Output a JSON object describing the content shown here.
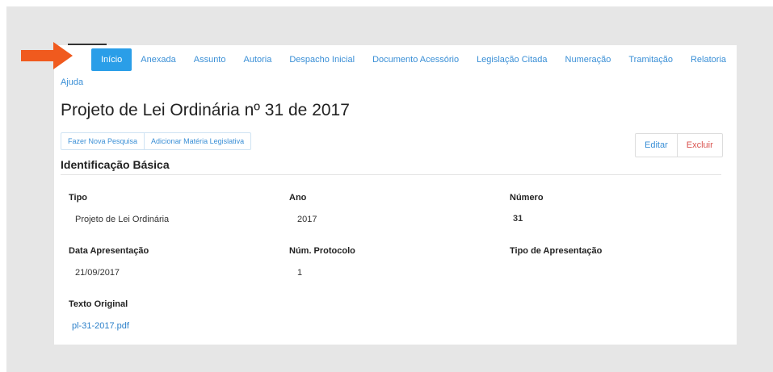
{
  "tabs": [
    {
      "label": "Início",
      "active": true
    },
    {
      "label": "Anexada"
    },
    {
      "label": "Assunto"
    },
    {
      "label": "Autoria"
    },
    {
      "label": "Despacho Inicial"
    },
    {
      "label": "Documento Acessório"
    },
    {
      "label": "Legislação Citada"
    },
    {
      "label": "Numeração"
    },
    {
      "label": "Tramitação"
    },
    {
      "label": "Relatoria"
    }
  ],
  "help_label": "Ajuda",
  "page_title": "Projeto de Lei Ordinária nº 31 de 2017",
  "actions": {
    "new_search": "Fazer Nova Pesquisa",
    "add_matter": "Adicionar Matéria Legislativa",
    "edit": "Editar",
    "delete": "Excluir"
  },
  "section_title": "Identificação Básica",
  "fields": {
    "tipo": {
      "label": "Tipo",
      "value": "Projeto de Lei Ordinária"
    },
    "ano": {
      "label": "Ano",
      "value": "2017"
    },
    "numero": {
      "label": "Número",
      "value": "31"
    },
    "data_apresentacao": {
      "label": "Data Apresentação",
      "value": "21/09/2017"
    },
    "num_protocolo": {
      "label": "Núm. Protocolo",
      "value": "1"
    },
    "tipo_apresentacao": {
      "label": "Tipo de Apresentação",
      "value": ""
    },
    "texto_original": {
      "label": "Texto Original",
      "value": "pl-31-2017.pdf"
    }
  },
  "colors": {
    "accent": "#2a9ee8",
    "link": "#3a8fd6",
    "danger": "#d9534f",
    "arrow": "#f05a1e"
  }
}
